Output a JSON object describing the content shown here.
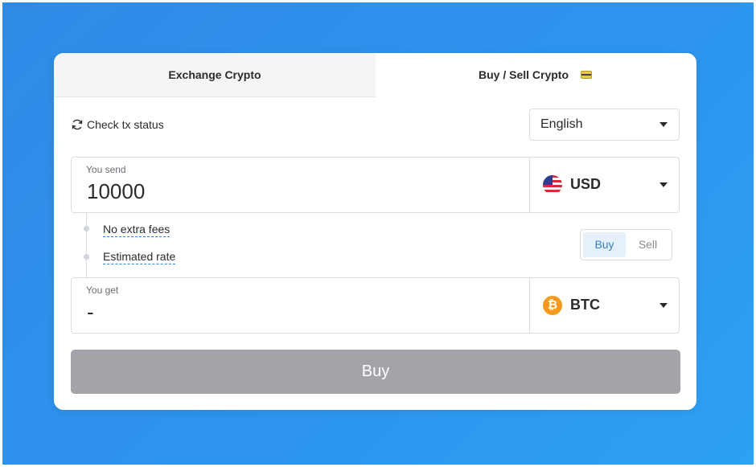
{
  "tabs": {
    "exchange_label": "Exchange Crypto",
    "buy_sell_label": "Buy / Sell Crypto",
    "buy_sell_icon": "credit-card-icon"
  },
  "status": {
    "label": "Check tx status",
    "icon": "refresh-icon"
  },
  "language": {
    "selected": "English"
  },
  "send": {
    "label": "You send",
    "amount": "10000",
    "currency": "USD",
    "currency_icon": "us-flag-icon"
  },
  "info": {
    "fees": "No extra fees",
    "rate": "Estimated rate"
  },
  "mode_toggle": {
    "buy_label": "Buy",
    "sell_label": "Sell",
    "active": "Buy"
  },
  "get": {
    "label": "You get",
    "amount": "-",
    "currency": "BTC",
    "currency_icon": "bitcoin-icon",
    "currency_symbol": "₿"
  },
  "action": {
    "label": "Buy"
  },
  "colors": {
    "background": "#2d95ee",
    "accent": "#2f7fd6",
    "button_disabled": "#a3a3a9",
    "btc_orange": "#f59a1c"
  }
}
